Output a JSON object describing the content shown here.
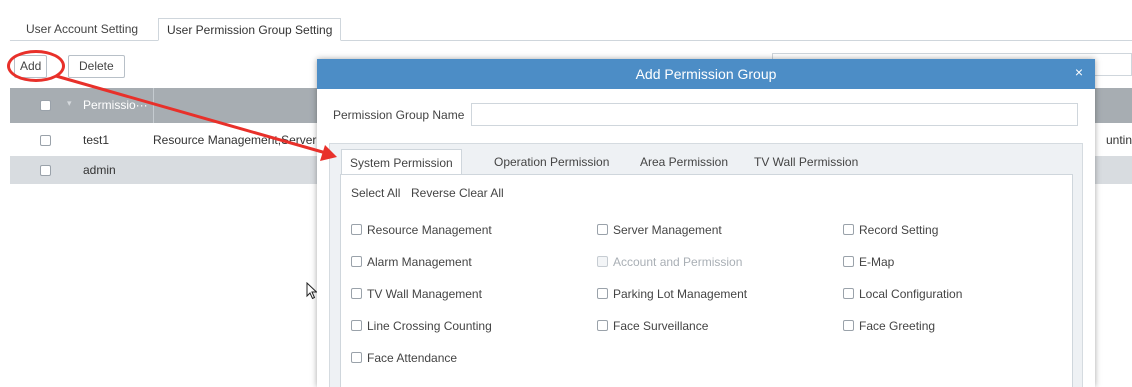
{
  "top_tabs": [
    "User Account Setting",
    "User Permission Group Setting"
  ],
  "toolbar": {
    "add_label": "Add",
    "delete_label": "Delete"
  },
  "table": {
    "header": {
      "column_name": "Permissio···"
    },
    "rows": [
      {
        "name": "test1",
        "permissions": "Resource Management,Server",
        "tail": "unting,I"
      },
      {
        "name": "admin",
        "permissions": "",
        "tail": ""
      }
    ]
  },
  "modal": {
    "title": "Add Permission Group",
    "close": "×",
    "group_name_label": "Permission Group Name",
    "group_name_value": "",
    "tabs": [
      "System Permission",
      "Operation Permission",
      "Area Permission",
      "TV Wall Permission"
    ],
    "controls": {
      "select_all": "Select All",
      "reverse": "Reverse",
      "clear_all": "Clear All"
    },
    "permissions": [
      [
        "Resource Management",
        "Server Management",
        "Record Setting"
      ],
      [
        "Alarm Management",
        "Account and Permission",
        "E-Map"
      ],
      [
        "TV Wall Management",
        "Parking Lot Management",
        "Local Configuration"
      ],
      [
        "Line Crossing Counting",
        "Face Surveillance",
        "Face Greeting"
      ],
      [
        "Face Attendance"
      ]
    ]
  },
  "colors": {
    "title_bar": "#4c8dc6",
    "annotation": "#e8302a",
    "header": "#a7adb2"
  }
}
